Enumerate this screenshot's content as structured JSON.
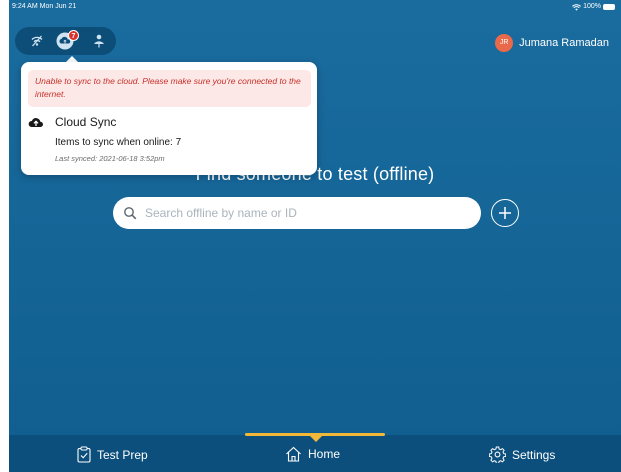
{
  "status_bar": {
    "time": "9:24 AM",
    "date": "Mon Jun 21",
    "battery_percent": "100%",
    "wifi_icon": "wifi-icon",
    "battery_icon": "battery-icon"
  },
  "toolbar": {
    "icons": [
      "wifi-off-icon",
      "cloud-sync-icon",
      "person-icon"
    ],
    "sync_badge_count": "7"
  },
  "user": {
    "initials": "JR",
    "name": "Jumana Ramadan",
    "avatar_color": "#e9694a"
  },
  "sync_popover": {
    "error_message": "Unable to sync to the cloud. Please make sure you're connected to the internet.",
    "title": "Cloud Sync",
    "items_to_sync": "Items to sync when online: 7",
    "last_synced": "Last synced: 2021-06-18 3:52pm"
  },
  "main": {
    "title": "Find someone to test (offline)",
    "search_placeholder": "Search offline by name or ID",
    "search_value": ""
  },
  "bottom_nav": {
    "tabs": [
      {
        "label": "Test Prep",
        "icon": "clipboard-check-icon"
      },
      {
        "label": "Home",
        "icon": "home-icon",
        "active": true
      },
      {
        "label": "Settings",
        "icon": "gear-icon"
      }
    ],
    "active_indicator_color": "#f2b939"
  },
  "colors": {
    "background": "#105e8f",
    "error_text": "#c8312b",
    "error_background": "#fce8e6",
    "badge": "#d9312b"
  }
}
